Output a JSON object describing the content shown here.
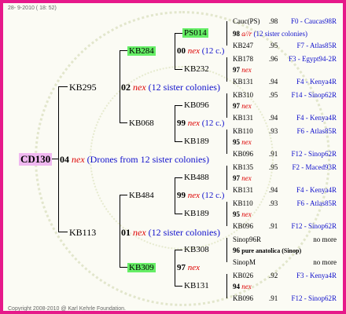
{
  "header": "28- 9-2010 ( 18: 52)",
  "footer": "Copyright 2008-2010 @ Karl Kehrle Foundation.",
  "root": {
    "name": "CD130",
    "gen": "04",
    "suffix": "nex",
    "note": "(Drones from 12 sister colonies)"
  },
  "gen1": [
    {
      "name": "KB295",
      "gen": "02",
      "suffix": "nex",
      "note": "(12 sister colonies)"
    },
    {
      "name": "KB113",
      "gen": "01",
      "suffix": "nex",
      "note": "(12 sister colonies)"
    }
  ],
  "gen2": [
    {
      "name": "KB284",
      "gen": "00",
      "suffix": "nex",
      "note": "(12 c.)"
    },
    {
      "name": "KB068",
      "gen": "99",
      "suffix": "nex",
      "note": "(12 c.)"
    },
    {
      "name": "KB484",
      "gen": "99",
      "suffix": "nex",
      "note": "(12 c.)"
    },
    {
      "name": "KB309",
      "gen": "97",
      "suffix": "nex",
      "note": ""
    }
  ],
  "gen3": [
    "PS014",
    "KB232",
    "KB096",
    "KB189",
    "KB488",
    "KB189",
    "KB308",
    "KB131"
  ],
  "gen4": [
    {
      "name": "Cauc(PS)",
      "pct": ".98",
      "origin": "F0 - Caucas98R"
    },
    {
      "name": "98",
      "pct": "",
      "origin": ""
    },
    {
      "name": "KB247",
      "pct": ".95",
      "origin": "F7 - Atlas85R"
    },
    {
      "name": "KB178",
      "pct": ".96",
      "origin": "F3 - Egypt94-2R"
    },
    {
      "name": "97",
      "pct": "",
      "origin": ""
    },
    {
      "name": "KB131",
      "pct": ".94",
      "origin": "F4 - Kenya4R"
    },
    {
      "name": "KB310",
      "pct": ".95",
      "origin": "F14 - Sinop62R"
    },
    {
      "name": "97",
      "pct": "",
      "origin": ""
    },
    {
      "name": "KB131",
      "pct": ".94",
      "origin": "F4 - Kenya4R"
    },
    {
      "name": "KB110",
      "pct": ".93",
      "origin": "F6 - Atlas85R"
    },
    {
      "name": "95",
      "pct": "",
      "origin": ""
    },
    {
      "name": "KB096",
      "pct": ".91",
      "origin": "F12 - Sinop62R"
    },
    {
      "name": "KB135",
      "pct": ".95",
      "origin": "F2 - Maced93R"
    },
    {
      "name": "97",
      "pct": "",
      "origin": ""
    },
    {
      "name": "KB131",
      "pct": ".94",
      "origin": "F4 - Kenya4R"
    },
    {
      "name": "KB110",
      "pct": ".93",
      "origin": "F6 - Atlas85R"
    },
    {
      "name": "95",
      "pct": "",
      "origin": ""
    },
    {
      "name": "KB096",
      "pct": ".91",
      "origin": "F12 - Sinop62R"
    },
    {
      "name": "Sinop96R",
      "pct": "",
      "origin": "no more"
    },
    {
      "name": "96",
      "pct": "",
      "origin": ""
    },
    {
      "name": "SinopM",
      "pct": "",
      "origin": "no more"
    },
    {
      "name": "KB026",
      "pct": ".92",
      "origin": "F3 - Kenya4R"
    },
    {
      "name": "94",
      "pct": "",
      "origin": ""
    },
    {
      "name": "KB096",
      "pct": ".91",
      "origin": "F12 - Sinop62R"
    }
  ],
  "extras": {
    "e1_suffix": "a//r",
    "e1_note": "(12 sister colonies)",
    "nex": "nex",
    "e20_note": "pure anatolica (Sinop)"
  }
}
